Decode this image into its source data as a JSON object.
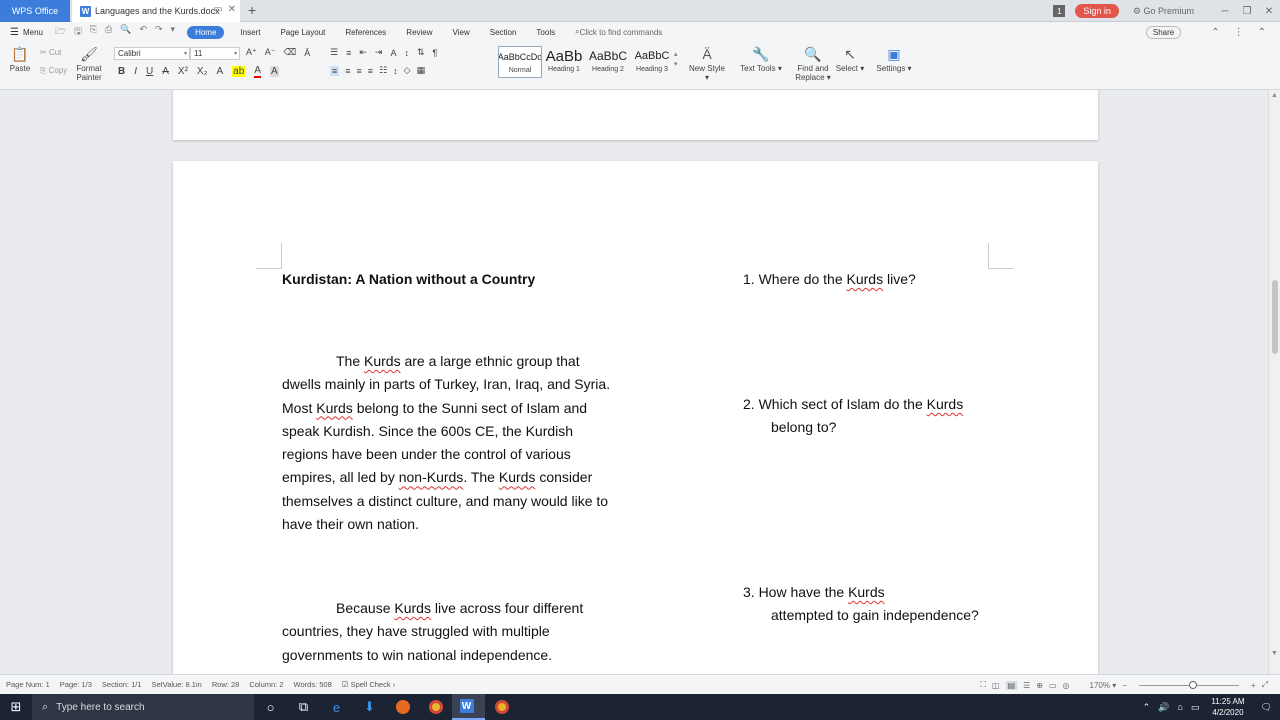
{
  "titlebar": {
    "app_tab": "WPS Office",
    "doc_tab": "Languages and the Kurds.docx",
    "notif_count": "1",
    "signin": "Sign in",
    "premium": "Go Premium"
  },
  "menubar": {
    "menu": "Menu",
    "tabs": [
      "Home",
      "Insert",
      "Page Layout",
      "References",
      "Review",
      "View",
      "Section",
      "Tools"
    ],
    "find_commands": "Click to find commands",
    "share": "Share"
  },
  "ribbon": {
    "paste": "Paste",
    "cut": "Cut",
    "copy": "Copy",
    "format_painter_1": "Format",
    "format_painter_2": "Painter",
    "font_name": "Calibri",
    "font_size": "11",
    "styles": [
      {
        "sample": "AaBbCcDd",
        "name": "Normal"
      },
      {
        "sample": "AaBb",
        "name": "Heading 1"
      },
      {
        "sample": "AaBbC",
        "name": "Heading 2"
      },
      {
        "sample": "AaBbC",
        "name": "Heading 3"
      }
    ],
    "new_style": "New Style",
    "text_tools": "Text Tools",
    "find_replace_1": "Find and",
    "find_replace_2": "Replace",
    "select": "Select",
    "settings": "Settings"
  },
  "document": {
    "title": "Kurdistan: A Nation without a Country",
    "para1": [
      "The ",
      "Kurds",
      " are a large ethnic group that dwells mainly in parts of Turkey, Iran, Iraq, and Syria. Most ",
      "Kurds",
      " belong to the Sunni sect of Islam and speak Kurdish. Since the 600s CE, the Kurdish regions have been under the control of various empires, all led by ",
      "non-Kurds",
      ". The ",
      "Kurds",
      " consider themselves a distinct culture, and many would like to have their own nation."
    ],
    "para2": [
      "Because ",
      "Kurds",
      " live across four different countries, they have struggled with multiple governments to win national independence."
    ],
    "q1": [
      "1. Where do the ",
      "Kurds",
      " live?"
    ],
    "q2": [
      "2. Which sect of Islam do the ",
      "Kurds",
      " belong to?"
    ],
    "q3": [
      "3.  How have the ",
      "Kurds",
      " attempted to gain independence?"
    ]
  },
  "statusbar": {
    "page_num": "Page Num: 1",
    "page": "Page: 1/3",
    "section": "Section: 1/1",
    "set_value": "SetValue: 8.1in",
    "row": "Row: 28",
    "column": "Column: 2",
    "words": "Words: 508",
    "spell_check": "Spell Check",
    "zoom": "170%"
  },
  "taskbar": {
    "search_placeholder": "Type here to search",
    "time": "11:25 AM",
    "date": "4/2/2020"
  }
}
